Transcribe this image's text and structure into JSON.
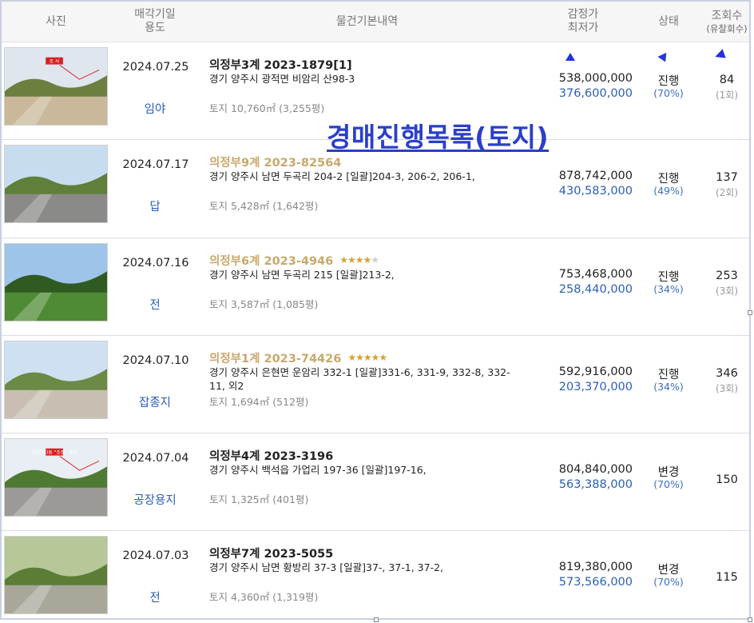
{
  "header": {
    "photo": "사진",
    "date_line1": "매각기일",
    "date_line2": "용도",
    "info": "물건기본내역",
    "price_line1": "감정가",
    "price_line2": "최저가",
    "status": "상태",
    "views_line1": "조회수",
    "views_line2": "(유찰회수)"
  },
  "overlay_title": "경매진행목록(토지)",
  "rows": [
    {
      "date": "2024.07.25",
      "use": "임야",
      "case": "의정부3계 2023-1879[1]",
      "highlight": false,
      "stars": 0,
      "address": "경기 양주시 광적면 비암리 산98-3",
      "area": "토지 10,760㎡ (3,255평)",
      "appraisal": "538,000,000",
      "minimum": "376,600,000",
      "status": "진행",
      "percent": "(70%)",
      "views": "84",
      "fails": "(1회)"
    },
    {
      "date": "2024.07.17",
      "use": "답",
      "case": "의정부9계 2023-82564",
      "highlight": true,
      "stars": 0,
      "address": "경기 양주시 남면 두곡리 204-2  [일괄]204-3, 206-2, 206-1,",
      "area": "토지 5,428㎡ (1,642평)",
      "appraisal": "878,742,000",
      "minimum": "430,583,000",
      "status": "진행",
      "percent": "(49%)",
      "views": "137",
      "fails": "(2회)"
    },
    {
      "date": "2024.07.16",
      "use": "전",
      "case": "의정부6계 2023-4946",
      "highlight": true,
      "stars": 4,
      "address": "경기 양주시 남면 두곡리 215  [일괄]213-2,",
      "area": "토지 3,587㎡ (1,085평)",
      "appraisal": "753,468,000",
      "minimum": "258,440,000",
      "status": "진행",
      "percent": "(34%)",
      "views": "253",
      "fails": "(3회)"
    },
    {
      "date": "2024.07.10",
      "use": "잡종지",
      "case": "의정부1계 2023-74426",
      "highlight": true,
      "stars": 5,
      "address": "경기 양주시 은현면 운암리 332-1  [일괄]331-6, 331-9, 332-8, 332-11, 외2",
      "area": "토지 1,694㎡ (512평)",
      "appraisal": "592,916,000",
      "minimum": "203,370,000",
      "status": "진행",
      "percent": "(34%)",
      "views": "346",
      "fails": "(3회)"
    },
    {
      "date": "2024.07.04",
      "use": "공장용지",
      "case": "의정부4계 2023-3196",
      "highlight": false,
      "stars": 0,
      "address": "경기 양주시 백석읍 가업리 197-36  [일괄]197-16,",
      "area": "토지 1,325㎡ (401평)",
      "appraisal": "804,840,000",
      "minimum": "563,388,000",
      "status": "변경",
      "percent": "(70%)",
      "views": "150",
      "fails": ""
    },
    {
      "date": "2024.07.03",
      "use": "전",
      "case": "의정부7계 2023-5055",
      "highlight": false,
      "stars": 0,
      "address": "경기 양주시 남면 황방리 37-3  [일괄]37-, 37-1, 37-2,",
      "area": "토지 4,360㎡ (1,319평)",
      "appraisal": "819,380,000",
      "minimum": "573,566,000",
      "status": "변경",
      "percent": "(70%)",
      "views": "115",
      "fails": ""
    }
  ],
  "photos": [
    {
      "icon": "forest-hillside-photo",
      "sky": "#dfe6ee",
      "ground": "#c9b89a",
      "hill": "#6d7f3f",
      "marker_text": "조 사"
    },
    {
      "icon": "rural-road-photo",
      "sky": "#c8dcf0",
      "ground": "#8a8a88",
      "hill": "#5f7f3a",
      "marker_text": ""
    },
    {
      "icon": "field-trees-photo",
      "sky": "#9fc4ea",
      "ground": "#4f8a34",
      "hill": "#2f5b22",
      "marker_text": ""
    },
    {
      "icon": "gravel-lot-photo",
      "sky": "#cfe0f2",
      "ground": "#c8bfb2",
      "hill": "#6a8a45",
      "marker_text": ""
    },
    {
      "icon": "factory-alley-photo",
      "sky": "#e8eef4",
      "ground": "#9c9a96",
      "hill": "#4f7a32",
      "marker_text": "조정(지)동 \"조정\" 표면"
    },
    {
      "icon": "concrete-slab-photo",
      "sky": "#b7c79a",
      "ground": "#a9a79a",
      "hill": "#5c7d36",
      "marker_text": ""
    }
  ],
  "colors": {
    "accent_blue": "#2b5fb3",
    "highlight_case": "#c8a96b",
    "overlay": "#2a3fc9",
    "star": "#d6a235"
  }
}
